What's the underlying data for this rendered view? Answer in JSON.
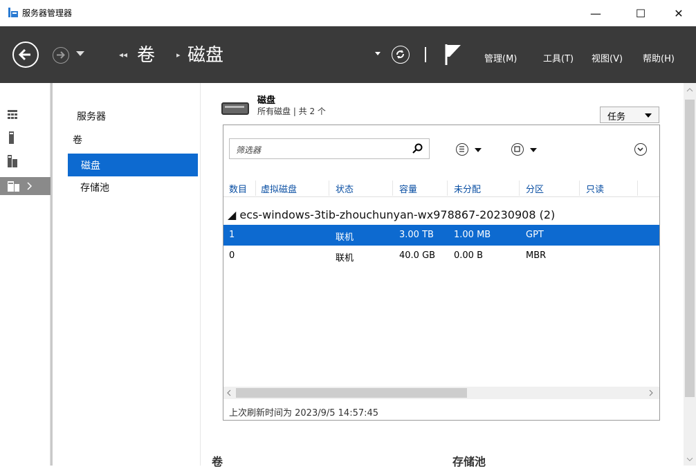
{
  "window": {
    "title": "服务器管理器",
    "minimize": "—",
    "maximize": "☐",
    "close": "✕"
  },
  "navbar": {
    "breadcrumb_chev": "◂◂",
    "breadcrumb_sep": "▸",
    "breadcrumb": [
      "卷",
      "磁盘"
    ],
    "menus": [
      "管理(M)",
      "工具(T)",
      "视图(V)",
      "帮助(H)"
    ]
  },
  "tree": {
    "items": [
      {
        "label": "服务器"
      },
      {
        "label": "卷"
      },
      {
        "label": "磁盘"
      },
      {
        "label": "存储池"
      }
    ]
  },
  "tile": {
    "title": "磁盘",
    "subtitle": "所有磁盘 | 共 2 个",
    "tasks_label": "任务"
  },
  "filter": {
    "placeholder": "筛选器"
  },
  "table": {
    "columns": [
      "数目",
      "虚拟磁盘",
      "状态",
      "容量",
      "未分配",
      "分区",
      "只读"
    ],
    "group": "◢  ecs-windows-3tib-zhouchunyan-wx978867-20230908 (2)",
    "rows": [
      {
        "number": "1",
        "virtual": "",
        "status": "联机",
        "capacity": "3.00 TB",
        "unallocated": "1.00 MB",
        "partition": "GPT",
        "readonly": ""
      },
      {
        "number": "0",
        "virtual": "",
        "status": "联机",
        "capacity": "40.0 GB",
        "unallocated": "0.00 B",
        "partition": "MBR",
        "readonly": ""
      }
    ]
  },
  "refresh_info": "上次刷新时间为 2023/9/5 14:57:45",
  "sections": {
    "volumes": "卷",
    "pools": "存储池"
  },
  "colors": {
    "navbar": "#3a3a3a",
    "selection": "#0d6ad0",
    "header_text": "#0a4fa3"
  }
}
